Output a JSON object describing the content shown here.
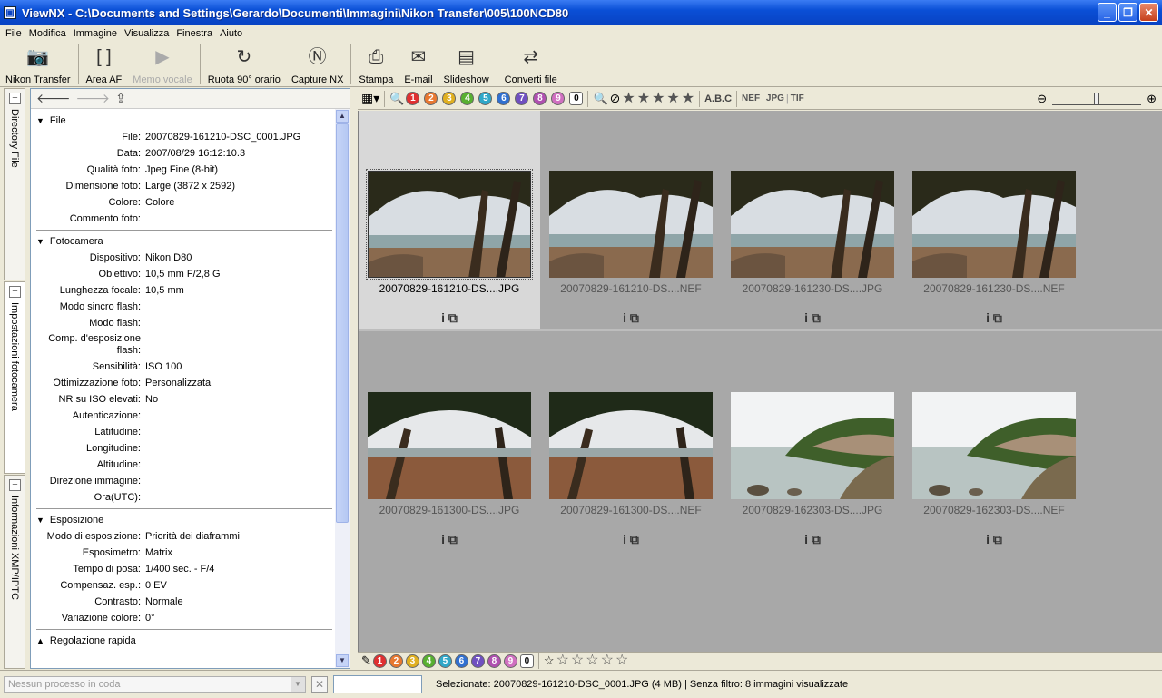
{
  "window": {
    "title": "ViewNX - C:\\Documents and Settings\\Gerardo\\Documenti\\Immagini\\Nikon Transfer\\005\\100NCD80"
  },
  "menu": [
    "File",
    "Modifica",
    "Immagine",
    "Visualizza",
    "Finestra",
    "Aiuto"
  ],
  "toolbar": {
    "nikon_transfer": "Nikon Transfer",
    "area_af": "Area AF",
    "memo_vocale": "Memo vocale",
    "ruota": "Ruota 90° orario",
    "capture_nx": "Capture NX",
    "stampa": "Stampa",
    "email": "E-mail",
    "slideshow": "Slideshow",
    "converti": "Converti file"
  },
  "left_tabs": [
    "Directory File",
    "Impostazioni fotocamera",
    "Informazioni XMP/IPTC"
  ],
  "metadata": {
    "file": {
      "title": "File",
      "rows": [
        {
          "k": "File:",
          "v": "20070829-161210-DSC_0001.JPG"
        },
        {
          "k": "Data:",
          "v": "2007/08/29 16:12:10.3"
        },
        {
          "k": "Qualità foto:",
          "v": "Jpeg Fine (8-bit)"
        },
        {
          "k": "Dimensione foto:",
          "v": "Large (3872 x 2592)"
        },
        {
          "k": "Colore:",
          "v": "Colore"
        },
        {
          "k": "Commento foto:",
          "v": ""
        }
      ]
    },
    "camera": {
      "title": "Fotocamera",
      "rows": [
        {
          "k": "Dispositivo:",
          "v": "Nikon D80"
        },
        {
          "k": "Obiettivo:",
          "v": "10,5 mm F/2,8 G"
        },
        {
          "k": "Lunghezza focale:",
          "v": "10,5 mm"
        },
        {
          "k": "Modo sincro flash:",
          "v": ""
        },
        {
          "k": "Modo flash:",
          "v": ""
        },
        {
          "k": "Comp. d'esposizione flash:",
          "v": ""
        },
        {
          "k": "Sensibilità:",
          "v": "ISO 100"
        },
        {
          "k": "Ottimizzazione foto:",
          "v": "Personalizzata"
        },
        {
          "k": "NR su ISO elevati:",
          "v": "No"
        },
        {
          "k": "Autenticazione:",
          "v": ""
        },
        {
          "k": "Latitudine:",
          "v": ""
        },
        {
          "k": "Longitudine:",
          "v": ""
        },
        {
          "k": "Altitudine:",
          "v": ""
        },
        {
          "k": "Direzione immagine:",
          "v": ""
        },
        {
          "k": "Ora(UTC):",
          "v": ""
        }
      ]
    },
    "exposure": {
      "title": "Esposizione",
      "rows": [
        {
          "k": "Modo di esposizione:",
          "v": "Priorità dei diaframmi"
        },
        {
          "k": "Esposimetro:",
          "v": "Matrix"
        },
        {
          "k": "Tempo di posa:",
          "v": "1/400 sec. - F/4"
        },
        {
          "k": "Compensaz. esp.:",
          "v": "0 EV"
        },
        {
          "k": "Contrasto:",
          "v": "Normale"
        },
        {
          "k": "Variazione colore:",
          "v": "0°"
        }
      ]
    },
    "quick": {
      "title": "Regolazione rapida"
    }
  },
  "grid_toolbar": {
    "labels": [
      "1",
      "2",
      "3",
      "4",
      "5",
      "6",
      "7",
      "8",
      "9",
      "0"
    ],
    "label_colors": [
      "#e03030",
      "#e87830",
      "#e0b020",
      "#58b030",
      "#30a8c8",
      "#3070d0",
      "#7050c0",
      "#b050b0",
      "#d070c0",
      "#ffffff"
    ],
    "sort": "A.B.C",
    "formats": [
      "NEF",
      "JPG",
      "TIF"
    ]
  },
  "thumbnails": [
    {
      "name": "20070829-161210-DS....JPG",
      "scene": "trees",
      "selected": true
    },
    {
      "name": "20070829-161210-DS....NEF",
      "scene": "trees",
      "selected": false
    },
    {
      "name": "20070829-161230-DS....JPG",
      "scene": "trees",
      "selected": false
    },
    {
      "name": "20070829-161230-DS....NEF",
      "scene": "trees",
      "selected": false
    },
    {
      "name": "20070829-161300-DS....JPG",
      "scene": "arch",
      "selected": false
    },
    {
      "name": "20070829-161300-DS....NEF",
      "scene": "arch",
      "selected": false
    },
    {
      "name": "20070829-162303-DS....JPG",
      "scene": "shore",
      "selected": false
    },
    {
      "name": "20070829-162303-DS....NEF",
      "scene": "shore",
      "selected": false
    }
  ],
  "status": {
    "queue": "Nessun processo in coda",
    "text": "Selezionate: 20070829-161210-DSC_0001.JPG (4 MB) | Senza filtro: 8 immagini visualizzate"
  }
}
